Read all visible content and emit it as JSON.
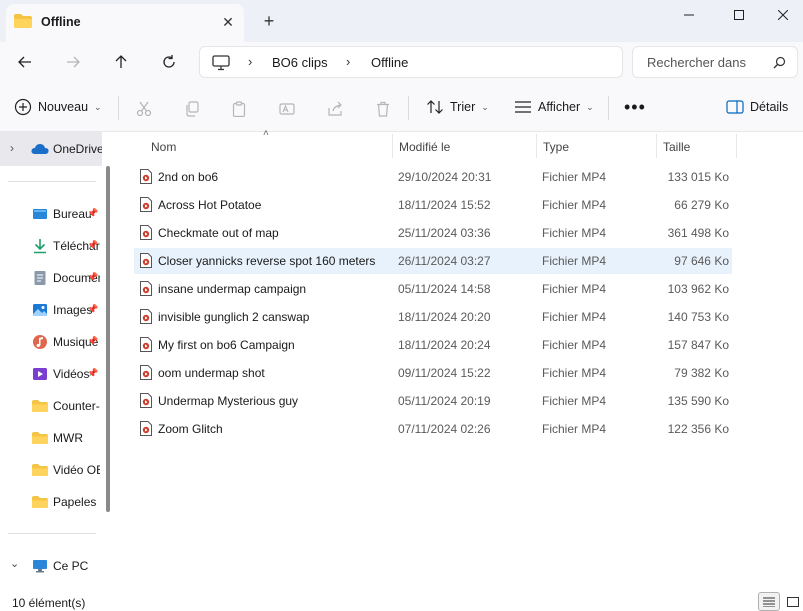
{
  "window": {
    "tab_title": "Offline",
    "colors": {
      "folder": "#f6c443",
      "accent": "#0067c0",
      "selection": "#e8f2fc"
    }
  },
  "address": {
    "crumbs": [
      "BO6 clips",
      "Offline"
    ],
    "search_placeholder": "Rechercher dans"
  },
  "toolbar": {
    "new_label": "Nouveau",
    "sort_label": "Trier",
    "view_label": "Afficher",
    "details_label": "Détails"
  },
  "sidebar": {
    "top": {
      "label": "OneDrive"
    },
    "items": [
      {
        "label": "Bureau",
        "icon": "desktop-icon",
        "pinned": true
      },
      {
        "label": "Téléchargements",
        "icon": "download-icon",
        "pinned": true
      },
      {
        "label": "Documents",
        "icon": "document-icon",
        "pinned": true
      },
      {
        "label": "Images",
        "icon": "image-icon",
        "pinned": true
      },
      {
        "label": "Musique",
        "icon": "music-icon",
        "pinned": true
      },
      {
        "label": "Vidéos",
        "icon": "video-icon",
        "pinned": true
      },
      {
        "label": "Counter-",
        "icon": "folder-icon",
        "pinned": false
      },
      {
        "label": "MWR",
        "icon": "folder-icon",
        "pinned": false
      },
      {
        "label": "Vidéo OB",
        "icon": "folder-icon",
        "pinned": false
      },
      {
        "label": "Papeles",
        "icon": "folder-icon",
        "pinned": false
      }
    ],
    "pc": {
      "label": "Ce PC"
    }
  },
  "columns": {
    "name": "Nom",
    "modified": "Modifié le",
    "type": "Type",
    "size": "Taille"
  },
  "files": [
    {
      "name": "2nd on bo6",
      "modified": "29/10/2024 20:31",
      "type": "Fichier MP4",
      "size": "133 015 Ko"
    },
    {
      "name": "Across Hot Potatoe",
      "modified": "18/11/2024 15:52",
      "type": "Fichier MP4",
      "size": "66 279 Ko"
    },
    {
      "name": "Checkmate out of map",
      "modified": "25/11/2024 03:36",
      "type": "Fichier MP4",
      "size": "361 498 Ko"
    },
    {
      "name": "Closer yannicks reverse spot 160 meters",
      "modified": "26/11/2024 03:27",
      "type": "Fichier MP4",
      "size": "97 646 Ko",
      "selected": true
    },
    {
      "name": "insane undermap campaign",
      "modified": "05/11/2024 14:58",
      "type": "Fichier MP4",
      "size": "103 962 Ko"
    },
    {
      "name": "invisible gunglich 2 canswap",
      "modified": "18/11/2024 20:20",
      "type": "Fichier MP4",
      "size": "140 753 Ko"
    },
    {
      "name": "My first on bo6 Campaign",
      "modified": "18/11/2024 20:24",
      "type": "Fichier MP4",
      "size": "157 847 Ko"
    },
    {
      "name": "oom undermap shot",
      "modified": "09/11/2024 15:22",
      "type": "Fichier MP4",
      "size": "79 382 Ko"
    },
    {
      "name": "Undermap Mysterious guy",
      "modified": "05/11/2024 20:19",
      "type": "Fichier MP4",
      "size": "135 590 Ko"
    },
    {
      "name": "Zoom Glitch",
      "modified": "07/11/2024 02:26",
      "type": "Fichier MP4",
      "size": "122 356 Ko"
    }
  ],
  "status": {
    "count": "10 élément(s)"
  }
}
